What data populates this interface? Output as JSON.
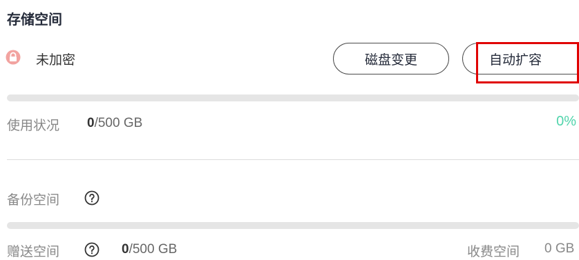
{
  "storage": {
    "title": "存储空间",
    "encryption_label": "未加密",
    "disk_change_button": "磁盘变更",
    "auto_expand_button": "自动扩容",
    "usage": {
      "label": "使用状况",
      "used": "0",
      "total": "/500 GB",
      "percent_text": "0%",
      "percent": 0
    },
    "backup": {
      "label": "备份空间"
    },
    "gift": {
      "label": "赠送空间",
      "used": "0",
      "total": "/500 GB"
    },
    "charged": {
      "label": "收费空间",
      "value": "0 GB"
    }
  },
  "colors": {
    "accent_green": "#50d4ab",
    "highlight_red": "#e00000",
    "lock_icon": "#f2a3a0"
  },
  "icons": {
    "lock": "lock-icon",
    "help": "question-circle-icon"
  }
}
